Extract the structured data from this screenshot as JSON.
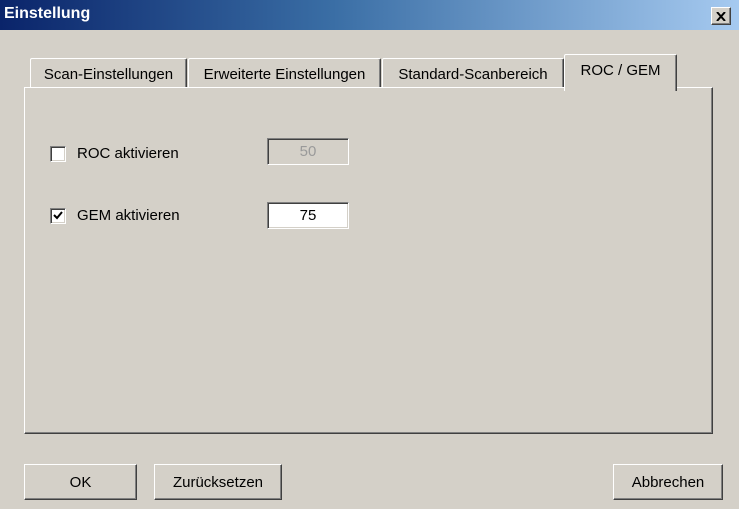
{
  "window": {
    "title": "Einstellung",
    "close_icon": "close-icon"
  },
  "tabs": [
    {
      "label": "Scan-Einstellungen",
      "active": false
    },
    {
      "label": "Erweiterte Einstellungen",
      "active": false
    },
    {
      "label": "Standard-Scanbereich",
      "active": false
    },
    {
      "label": "ROC / GEM",
      "active": true
    }
  ],
  "roc": {
    "label": "ROC aktivieren",
    "checked": false,
    "value": "50",
    "enabled": false
  },
  "gem": {
    "label": "GEM aktivieren",
    "checked": true,
    "value": "75",
    "enabled": true
  },
  "buttons": {
    "ok": "OK",
    "reset": "Zurücksetzen",
    "cancel": "Abbrechen"
  },
  "colors": {
    "face": "#d4d0c8",
    "title_start": "#0a246a",
    "title_end": "#a6caf0"
  }
}
